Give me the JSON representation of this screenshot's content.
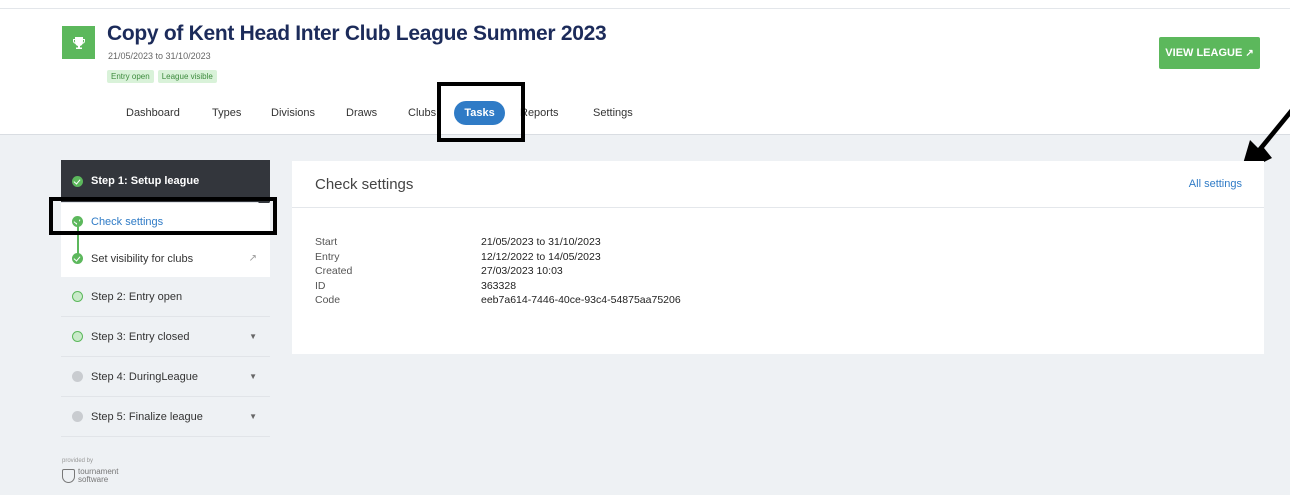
{
  "header": {
    "title": "Copy of Kent Head Inter Club League Summer 2023",
    "dates": "21/05/2023 to 31/10/2023",
    "badges": [
      "Entry open",
      "League visible"
    ],
    "view_button": "VIEW LEAGUE"
  },
  "nav": {
    "tabs": [
      "Dashboard",
      "Types",
      "Divisions",
      "Draws",
      "Clubs",
      "Tasks",
      "Reports",
      "Settings"
    ],
    "active": "Tasks"
  },
  "sidebar": {
    "step1": "Step 1: Setup league",
    "sub1": "Check settings",
    "sub2": "Set visibility for clubs",
    "step2": "Step 2: Entry open",
    "step3": "Step 3: Entry closed",
    "step4": "Step 4: DuringLeague",
    "step5": "Step 5: Finalize league"
  },
  "footer": {
    "provided_by": "provided by",
    "brand_line1": "tournament",
    "brand_line2": "software"
  },
  "card": {
    "title": "Check settings",
    "link": "All settings",
    "rows": [
      {
        "label": "Start",
        "value": "21/05/2023 to 31/10/2023"
      },
      {
        "label": "Entry",
        "value": "12/12/2022 to 14/05/2023"
      },
      {
        "label": "Created",
        "value": "27/03/2023 10:03"
      },
      {
        "label": "ID",
        "value": "363328"
      },
      {
        "label": "Code",
        "value": "eeb7a614-7446-40ce-93c4-54875aa75206"
      }
    ]
  },
  "colors": {
    "brand_green": "#5cb85c",
    "active_tab": "#2f7bc6",
    "title_navy": "#1c2b5a",
    "sidebar_dark": "#33363c"
  }
}
